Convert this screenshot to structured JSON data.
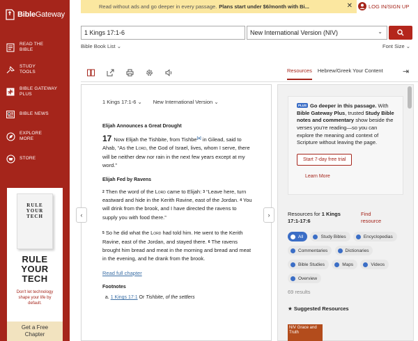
{
  "brand": {
    "name_bold": "Bible",
    "name_light": "Gateway"
  },
  "sidebar": {
    "items": [
      {
        "label": "READ THE BIBLE",
        "icon": "book-icon"
      },
      {
        "label": "STUDY TOOLS",
        "icon": "study-tools-icon"
      },
      {
        "label": "BIBLE GATEWAY PLUS",
        "icon": "plus-icon"
      },
      {
        "label": "BIBLE NEWS",
        "icon": "news-icon"
      },
      {
        "label": "EXPLORE MORE",
        "icon": "compass-icon"
      },
      {
        "label": "STORE",
        "icon": "store-icon"
      }
    ]
  },
  "ad": {
    "book_cover": "RULE YOUR TECH",
    "title": "RULE YOUR TECH",
    "subtitle": "Don't let technology shape your life by default.",
    "cta": "Get a Free Chapter"
  },
  "banner": {
    "text": "Read without ads and go deeper in every passage.",
    "bold": "Plans start under $6/month with Bi..."
  },
  "header": {
    "login": "LOG IN/SIGN UP"
  },
  "search": {
    "value": "1 Kings 17:1-6",
    "version": "New International Version (NIV)",
    "book_list": "Bible Book List",
    "font_size": "Font Size"
  },
  "tabs": {
    "resources": "Resources",
    "hebrew": "Hebrew/Greek Your Content"
  },
  "passage": {
    "ref": "1 Kings 17:1-6",
    "version": "New International Version",
    "heading1": "Elijah Announces a Great Drought",
    "chapter": "17",
    "v1a": "Now Elijah the Tishbite, from Tishbe",
    "v1_fn": "[a]",
    "v1b": " in Gilead, said to Ahab, “As the ",
    "lord": "Lord",
    "v1c": ", the God of Israel, lives, whom I serve, there will be neither dew nor rain in the next few years except at my word.”",
    "heading2": "Elijah Fed by Ravens",
    "v2n": "2",
    "v2a": " Then the word of the ",
    "v2b": " came to Elijah: ",
    "v3n": "3",
    "v3": " “Leave here, turn eastward and hide in the Kerith Ravine, east of the Jordan. ",
    "v4n": "4",
    "v4": " You will drink from the brook, and I have directed the ravens to supply you with food there.”",
    "v5n": "5",
    "v5a": " So he did what the ",
    "v5b": " had told him. He went to the Kerith Ravine, east of the Jordan, and stayed there. ",
    "v6n": "6",
    "v6": " The ravens brought him bread and meat in the morning and bread and meat in the evening, and he drank from the brook.",
    "read_full": "Read full chapter",
    "footnotes_heading": "Footnotes",
    "fn_label": "a.",
    "fn_link": "1 Kings 17:1",
    "fn_text": " Or ",
    "fn_italic": "Tishbite, of the settlers"
  },
  "promo": {
    "plus_badge": "PLUS",
    "headline": "Go deeper in this passage.",
    "t1": " With ",
    "b1": "Bible Gateway Plus",
    "t2": ", trusted ",
    "b2": "Study Bible notes and commentary",
    "t3": " show beside the verses you're reading—so you can explore the meaning and context of Scripture without leaving the page.",
    "cta": "Start 7-day free trial",
    "learn": "Learn More"
  },
  "resources": {
    "for_label": "Resources for ",
    "for_ref": "1 Kings 17:1-17:6",
    "find": "Find resource",
    "chips": [
      "All",
      "Study Bibles",
      "Encyclopedias",
      "Commentaries",
      "Dictionaries",
      "Bible Studies",
      "Maps",
      "Videos",
      "Overview"
    ],
    "count": "69 results",
    "suggested": "Suggested Resources",
    "sugg_img_text": "NIV Grace and Truth"
  }
}
